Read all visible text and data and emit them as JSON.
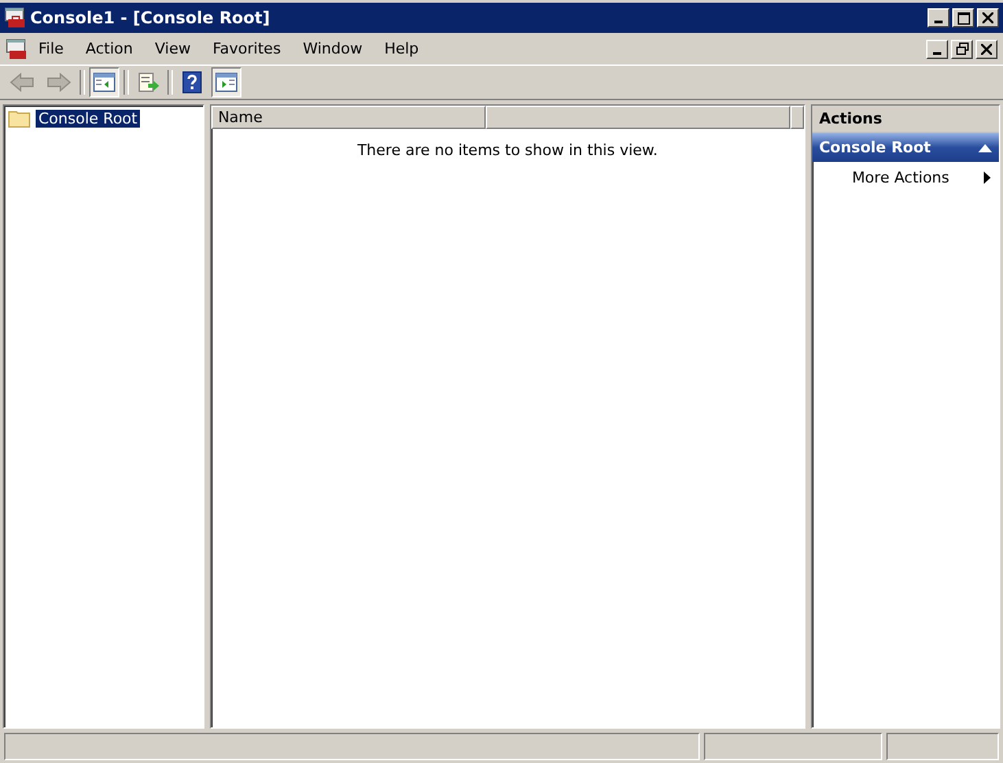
{
  "window": {
    "title": "Console1 - [Console Root]"
  },
  "menu": [
    "File",
    "Action",
    "View",
    "Favorites",
    "Window",
    "Help"
  ],
  "toolbar": [
    {
      "kind": "back",
      "disabled": true,
      "pressed": false
    },
    {
      "kind": "forward",
      "disabled": true,
      "pressed": false
    },
    {
      "kind": "sep"
    },
    {
      "kind": "tree",
      "disabled": false,
      "pressed": true
    },
    {
      "kind": "sep"
    },
    {
      "kind": "export",
      "disabled": false,
      "pressed": false
    },
    {
      "kind": "sep"
    },
    {
      "kind": "help",
      "disabled": false,
      "pressed": false
    },
    {
      "kind": "actionpane",
      "disabled": false,
      "pressed": true
    }
  ],
  "tree": [
    {
      "label": "Console Root",
      "selected": true
    }
  ],
  "list": {
    "columns": [
      "Name"
    ],
    "empty_message": "There are no items to show in this view."
  },
  "actions": {
    "title": "Actions",
    "groups": [
      {
        "title": "Console Root",
        "expanded": true,
        "items": [
          {
            "label": "More Actions"
          }
        ]
      }
    ]
  }
}
